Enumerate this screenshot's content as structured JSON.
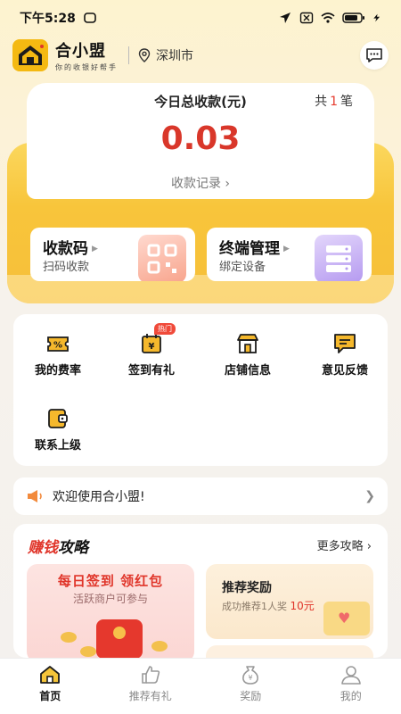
{
  "status_bar": {
    "time": "下午5:28"
  },
  "header": {
    "app_title": "合小盟",
    "app_slogan": "你的收银好帮手",
    "location": "深圳市",
    "icons": {
      "location": "location-pin-icon",
      "messages": "chat-bubble-icon"
    }
  },
  "summary": {
    "title": "今日总收款(元)",
    "count_prefix": "共",
    "count": "1",
    "count_suffix": "笔",
    "amount": "0.03",
    "records_link": "收款记录 ›"
  },
  "actions": [
    {
      "title": "收款码",
      "subtitle": "扫码收款",
      "icon": "qr-code-icon"
    },
    {
      "title": "终端管理",
      "subtitle": "绑定设备",
      "icon": "server-device-icon"
    }
  ],
  "grid": [
    {
      "label": "我的费率",
      "icon": "rate-ticket-icon"
    },
    {
      "label": "签到有礼",
      "icon": "calendar-yen-icon",
      "badge": "热门"
    },
    {
      "label": "店铺信息",
      "icon": "shop-icon"
    },
    {
      "label": "意见反馈",
      "icon": "feedback-icon"
    },
    {
      "label": "联系上级",
      "icon": "wallet-icon"
    }
  ],
  "notice": {
    "text": "欢迎使用合小盟!",
    "icon": "megaphone-icon"
  },
  "strategy": {
    "title_red": "赚钱",
    "title_black": "攻略",
    "more": "更多攻略 ›",
    "promo_left": {
      "title": "每日签到  领红包",
      "subtitle": "活跃商户可参与"
    },
    "promo_right": {
      "title": "推荐奖励",
      "subtitle_prefix": "成功推荐1人奖",
      "amount": "10元"
    }
  },
  "tabs": [
    {
      "label": "首页",
      "icon": "home-icon",
      "active": true
    },
    {
      "label": "推荐有礼",
      "icon": "thumbs-up-icon",
      "active": false
    },
    {
      "label": "奖励",
      "icon": "money-bag-icon",
      "active": false
    },
    {
      "label": "我的",
      "icon": "user-icon",
      "active": false
    }
  ],
  "colors": {
    "brand_yellow": "#f6bf39",
    "amount_red": "#d9372a",
    "accent_red": "#e0352a"
  }
}
